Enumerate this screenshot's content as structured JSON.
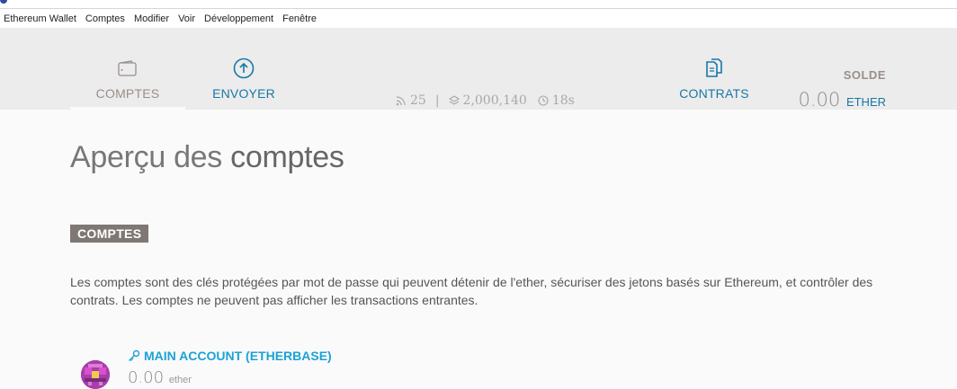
{
  "menu": {
    "items": [
      "Ethereum Wallet",
      "Comptes",
      "Modifier",
      "Voir",
      "Développement",
      "Fenêtre"
    ]
  },
  "nav": {
    "comptes_label": "COMPTES",
    "envoyer_label": "ENVOYER",
    "contrats_label": "CONTRATS"
  },
  "status": {
    "peers": "25",
    "block": "2,000,140",
    "time": "18s"
  },
  "balance": {
    "label": "SOLDE",
    "value": "0.00",
    "unit": "ETHER"
  },
  "page": {
    "title_light": "Aperçu des",
    "title_bold": "comptes",
    "section_tag": "COMPTES",
    "description": "Les comptes sont des clés protégées par mot de passe qui peuvent détenir de l'ether, sécuriser des jetons basés sur Ethereum, et contrôler des contrats. Les comptes ne peuvent pas afficher les transactions entrantes."
  },
  "accounts": [
    {
      "name": "MAIN ACCOUNT (ETHERBASE)",
      "balance": "0.00",
      "unit": "ether"
    }
  ],
  "colors": {
    "accent": "#1877a6",
    "account_name": "#1ca2d6",
    "tag_bg": "#7e7774",
    "header_bg": "#ececec"
  }
}
